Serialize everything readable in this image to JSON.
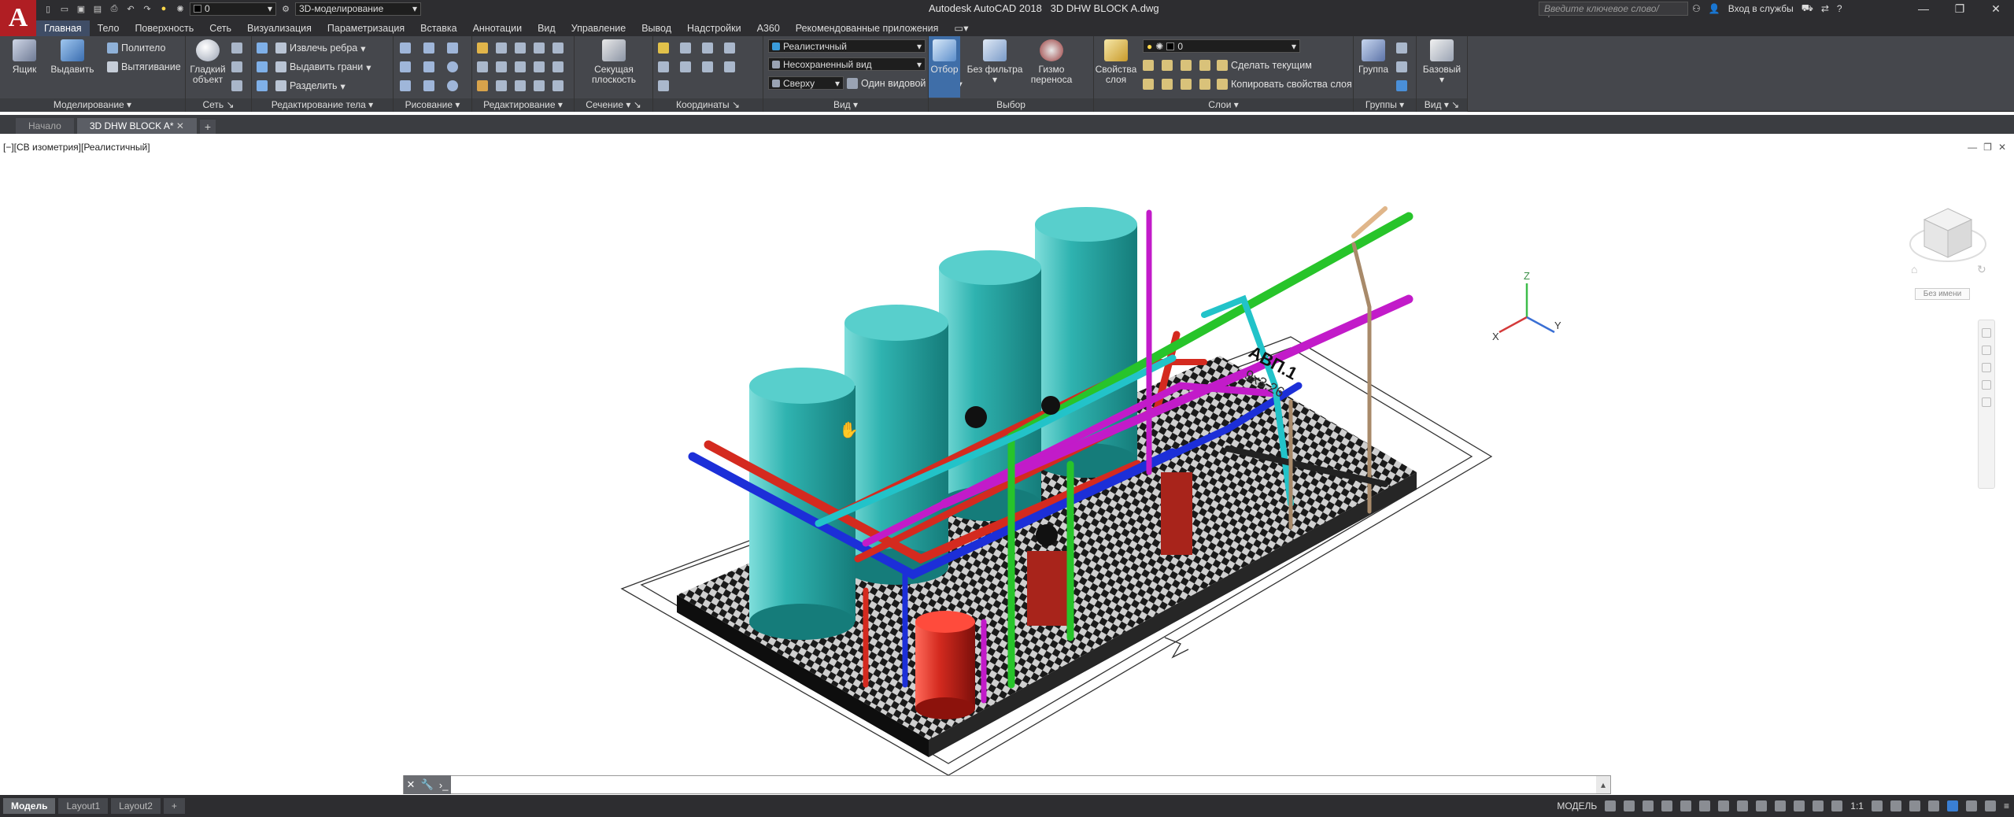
{
  "app": {
    "logo": "A",
    "title": "Autodesk AutoCAD 2018   3D DHW BLOCK A.dwg",
    "layer_value": "0",
    "workspace": "3D-моделирование",
    "search_placeholder": "Введите ключевое слово/фразу",
    "signin": "Вход в службы"
  },
  "menu_tabs": [
    {
      "label": "Главная",
      "active": true
    },
    {
      "label": "Тело"
    },
    {
      "label": "Поверхность"
    },
    {
      "label": "Сеть"
    },
    {
      "label": "Визуализация"
    },
    {
      "label": "Параметризация"
    },
    {
      "label": "Вставка"
    },
    {
      "label": "Аннотации"
    },
    {
      "label": "Вид"
    },
    {
      "label": "Управление"
    },
    {
      "label": "Вывод"
    },
    {
      "label": "Надстройки"
    },
    {
      "label": "A360"
    },
    {
      "label": "Рекомендованные приложения"
    }
  ],
  "ribbon": {
    "modeling": {
      "title": "Моделирование",
      "box": "Ящик",
      "extrude": "Выдавить",
      "polysolid": "Политело",
      "presspull": "Вытягивание"
    },
    "mesh": {
      "title": "Сеть",
      "smooth": "Гладкий объект"
    },
    "solid_edit": {
      "title": "Редактирование тела",
      "extract_edges": "Извлечь ребра",
      "extrude_faces": "Выдавить грани",
      "separate": "Разделить"
    },
    "draw": {
      "title": "Рисование"
    },
    "modify": {
      "title": "Редактирование"
    },
    "section": {
      "title": "Сечение",
      "plane": "Секущая плоскость"
    },
    "coordinates": {
      "title": "Координаты"
    },
    "view": {
      "title": "Вид",
      "visual_style": "Реалистичный",
      "named_view": "Несохраненный вид",
      "top": "Сверху",
      "one_viewport": "Один видовой экран"
    },
    "selection": {
      "title": "Выбор",
      "culling": "Отбор",
      "no_filter": "Без фильтра",
      "gizmo": "Гизмо переноса"
    },
    "layers": {
      "title": "Слои",
      "properties": "Свойства слоя",
      "layer_value": "0",
      "make_current": "Сделать текущим",
      "match_layer": "Копировать свойства слоя"
    },
    "groups": {
      "title": "Группы",
      "group": "Группа"
    },
    "view2": {
      "title": "Вид",
      "base": "Базовый"
    }
  },
  "doc_tabs": [
    {
      "label": "Начало"
    },
    {
      "label": "3D DHW BLOCK A*",
      "active": true
    }
  ],
  "viewport": {
    "label": "[−][СВ изометрия][Реалистичный]",
    "viewcube_label": "Без имени",
    "plan_text_1": "АВП.1",
    "plan_text_2": "9х3.26",
    "axis_x": "X",
    "axis_y": "Y",
    "axis_z": "Z"
  },
  "command_line": {
    "placeholder": ""
  },
  "layout_tabs": [
    {
      "label": "Модель",
      "active": true
    },
    {
      "label": "Layout1"
    },
    {
      "label": "Layout2"
    }
  ],
  "status": {
    "model": "МОДЕЛЬ",
    "scale": "1:1"
  },
  "colors": {
    "title_bg": "#2d2d30",
    "ribbon_bg": "#45474c",
    "logo_red": "#b01e23",
    "tank": "#2fb3b0",
    "pipe_red": "#d42a1f",
    "pipe_blue": "#1c2fd8",
    "pipe_magenta": "#c21bc9",
    "pipe_green": "#27c42a",
    "pipe_cyan": "#22c3c9"
  }
}
